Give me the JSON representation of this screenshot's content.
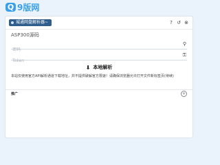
{
  "brand": {
    "badge": "Q",
    "name": "9版网"
  },
  "header": {
    "menu_label": "城通网盘解析器",
    "menu_caret": "~",
    "icons": [
      "help-circle-icon",
      "history-icon",
      "close-circle-icon"
    ]
  },
  "source_label": "ASP300源码",
  "password_field": {
    "placeholder": "密码",
    "value": ""
  },
  "token_field": {
    "placeholder": "Token",
    "value": ""
  },
  "parse_button": {
    "label": "本地解析"
  },
  "notice_text": "本站仅使用官方API解析通道下载地址，并不提供破解官方限速！请确保浏览器允许打开文件新标签页(待续)",
  "ad_label": "推广"
}
